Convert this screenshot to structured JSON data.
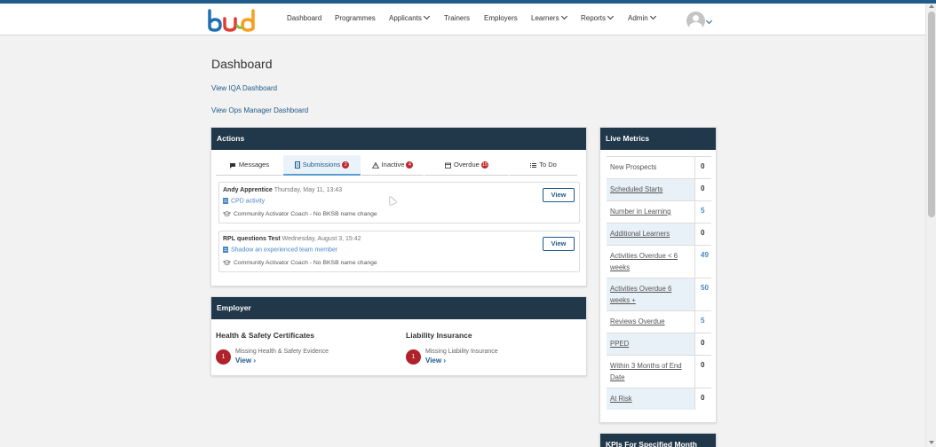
{
  "nav": {
    "items": [
      "Dashboard",
      "Programmes",
      "Applicants",
      "Trainers",
      "Employers",
      "Learners",
      "Reports",
      "Admin"
    ]
  },
  "page": {
    "title": "Dashboard",
    "iqa_link": "View IQA Dashboard",
    "ops_link": "View Ops Manager Dashboard"
  },
  "actions": {
    "title": "Actions",
    "tabs": [
      {
        "label": "Messages"
      },
      {
        "label": "Submissions",
        "badge": "2"
      },
      {
        "label": "Inactive",
        "badge": "4"
      },
      {
        "label": "Overdue",
        "badge": "15"
      },
      {
        "label": "To Do"
      }
    ],
    "submissions": [
      {
        "name": "Andy Apprentice",
        "when": "Thursday, May 11, 13:43",
        "activity": "CPD activity",
        "meta": "Community Activator Coach - No BKSB name change",
        "button": "View"
      },
      {
        "name": "RPL questions Test",
        "when": "Wednesday, August 3, 15:42",
        "activity": "Shadow an experienced team member",
        "meta": "Community Activator Coach - No BKSB name change",
        "button": "View"
      }
    ]
  },
  "employer": {
    "title": "Employer",
    "hs": {
      "heading": "Health & Safety Certificates",
      "count": "1",
      "missing": "Missing Health & Safety Evidence",
      "view": "View"
    },
    "li": {
      "heading": "Liability Insurance",
      "count": "1",
      "missing": "Missing Liability Insurance",
      "view": "View"
    }
  },
  "live_metrics": {
    "title": "Live Metrics",
    "rows": [
      {
        "label": "New Prospects",
        "value": "0"
      },
      {
        "label": "Scheduled Starts",
        "value": "0"
      },
      {
        "label": "Number in Learning",
        "value": "5"
      },
      {
        "label": "Additional Learners",
        "value": "0"
      },
      {
        "label": "Activities Overdue < 6 weeks",
        "value": "49"
      },
      {
        "label": "Activities Overdue 6 weeks +",
        "value": "50"
      },
      {
        "label": "Reviews Overdue",
        "value": "5"
      },
      {
        "label": "PPED",
        "value": "0"
      },
      {
        "label": "Within 3 Months of End Date",
        "value": "0"
      },
      {
        "label": "At Risk",
        "value": "0"
      }
    ]
  },
  "kpi": {
    "title": "KPIs For Specified Month"
  },
  "colors": {
    "header_bg": "#21374a",
    "link": "#1f5a8a",
    "badge": "#c0272d",
    "accent_stripe": "#1f5a8a"
  },
  "icons": [
    "bud-logo",
    "chevron-down-icon",
    "user-avatar-icon",
    "comment-icon",
    "file-icon",
    "warning-icon",
    "calendar-icon",
    "list-icon",
    "graduation-cap-icon",
    "chevron-right-icon"
  ]
}
